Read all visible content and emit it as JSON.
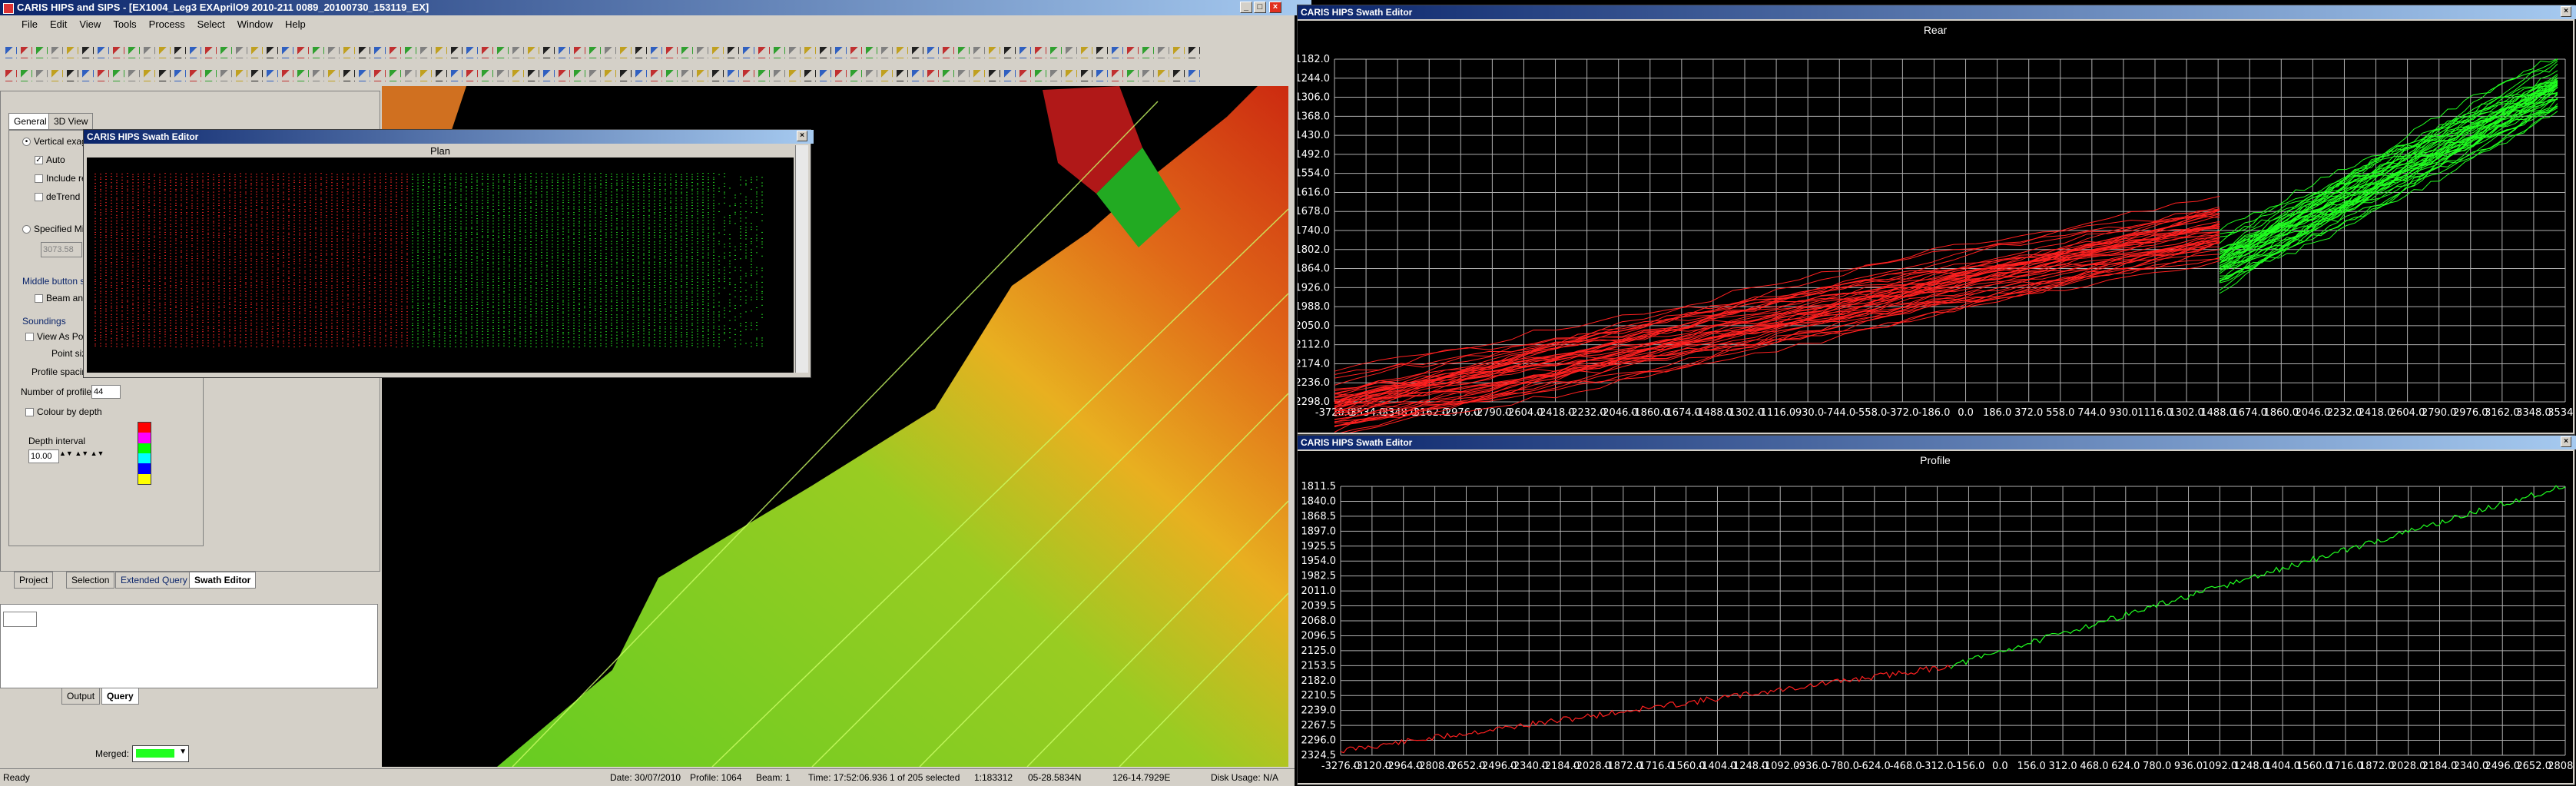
{
  "main_window": {
    "title": "CARIS HIPS and SIPS - [EX1004_Leg3 EXAprilO9 2010-211 0089_20100730_153119_EX]",
    "menu": [
      "File",
      "Edit",
      "View",
      "Tools",
      "Process",
      "Select",
      "Window",
      "Help"
    ]
  },
  "left_panel": {
    "tabs": [
      "General",
      "3D View"
    ],
    "vertical_exag_label": "Vertical exag",
    "auto_label": "Auto",
    "include_label": "Include re",
    "detrend_label": "deTrend",
    "specified_label": "Specified Mi",
    "specified_value": "3073.58",
    "middle_button_label": "Middle button se",
    "beam_label": "Beam and",
    "soundings_label": "Soundings",
    "view_as_points_label": "View As Poi",
    "point_size_label": "Point size",
    "profile_spacing_label": "Profile spacing",
    "number_of_profiles_label": "Number of profiles",
    "number_of_profiles_value": "44",
    "colour_by_depth_label": "Colour by depth",
    "depth_interval_label": "Depth interval",
    "depth_interval_value": "10.00",
    "bottom_tabs": [
      "Project",
      "Selection",
      "Extended Query",
      "Swath Editor"
    ],
    "lower_tabs": [
      "Output",
      "Query"
    ],
    "merged_label": "Merged:"
  },
  "plan_window": {
    "title": "CARIS HIPS Swath Editor",
    "view_title": "Plan"
  },
  "rear_window": {
    "title": "CARIS HIPS Swath Editor",
    "view_title": "Rear",
    "y_ticks": [
      "1182.0",
      "1244.0",
      "1306.0",
      "1368.0",
      "1430.0",
      "1492.0",
      "1554.0",
      "1616.0",
      "1678.0",
      "1740.0",
      "1802.0",
      "1864.0",
      "1926.0",
      "1988.0",
      "2050.0",
      "2112.0",
      "2174.0",
      "2236.0",
      "2298.0"
    ],
    "x_ticks": [
      "-3720.0",
      "-3534.0",
      "-3348.0",
      "-3162.0",
      "-2976.0",
      "-2790.0",
      "-2604.0",
      "-2418.0",
      "-2232.0",
      "-2046.0",
      "-1860.0",
      "-1674.0",
      "-1488.0",
      "-1302.0",
      "-1116.0",
      "-930.0",
      "-744.0",
      "-558.0",
      "-372.0",
      "-186.0",
      "0.0",
      "186.0",
      "372.0",
      "558.0",
      "744.0",
      "930.0",
      "1116.0",
      "1302.0",
      "1488.0",
      "1674.0",
      "1860.0",
      "2046.0",
      "2232.0",
      "2418.0",
      "2604.0",
      "2790.0",
      "2976.0",
      "3162.0",
      "3348.0",
      "3534.0"
    ]
  },
  "profile_window": {
    "title": "CARIS HIPS Swath Editor",
    "view_title": "Profile",
    "y_ticks": [
      "1811.5",
      "1840.0",
      "1868.5",
      "1897.0",
      "1925.5",
      "1954.0",
      "1982.5",
      "2011.0",
      "2039.5",
      "2068.0",
      "2096.5",
      "2125.0",
      "2153.5",
      "2182.0",
      "2210.5",
      "2239.0",
      "2267.5",
      "2296.0",
      "2324.5"
    ],
    "x_ticks": [
      "-3276.0",
      "-3120.0",
      "-2964.0",
      "-2808.0",
      "-2652.0",
      "-2496.0",
      "-2340.0",
      "-2184.0",
      "-2028.0",
      "-1872.0",
      "-1716.0",
      "-1560.0",
      "-1404.0",
      "-1248.0",
      "-1092.0",
      "-936.0",
      "-780.0",
      "-624.0",
      "-468.0",
      "-312.0",
      "-156.0",
      "0.0",
      "156.0",
      "312.0",
      "468.0",
      "624.0",
      "780.0",
      "936.0",
      "1092.0",
      "1248.0",
      "1404.0",
      "1560.0",
      "1716.0",
      "1872.0",
      "2028.0",
      "2184.0",
      "2340.0",
      "2496.0",
      "2652.0",
      "2808.0"
    ]
  },
  "status_bar": {
    "ready": "Ready",
    "date": "Date: 30/07/2010",
    "profile": "Profile: 1064",
    "beam": "Beam: 1",
    "time": "Time: 17:52:06.936",
    "selected": "1 of 205 selected",
    "scale": "1:183312",
    "lat": "05-28.5834N",
    "lon": "126-14.7929E",
    "disk": "Disk Usage: N/A"
  },
  "colors": {
    "title_dark": "#0a246a",
    "title_light": "#a6caf0",
    "red_series": "#ff2020",
    "green_series": "#20ff20",
    "grid": "#d0d0d0",
    "panel": "#d4d0c8"
  },
  "depth_colors": [
    "#ff0000",
    "#ff00ff",
    "#00ff00",
    "#00ffff",
    "#0000ff",
    "#ffff00"
  ]
}
